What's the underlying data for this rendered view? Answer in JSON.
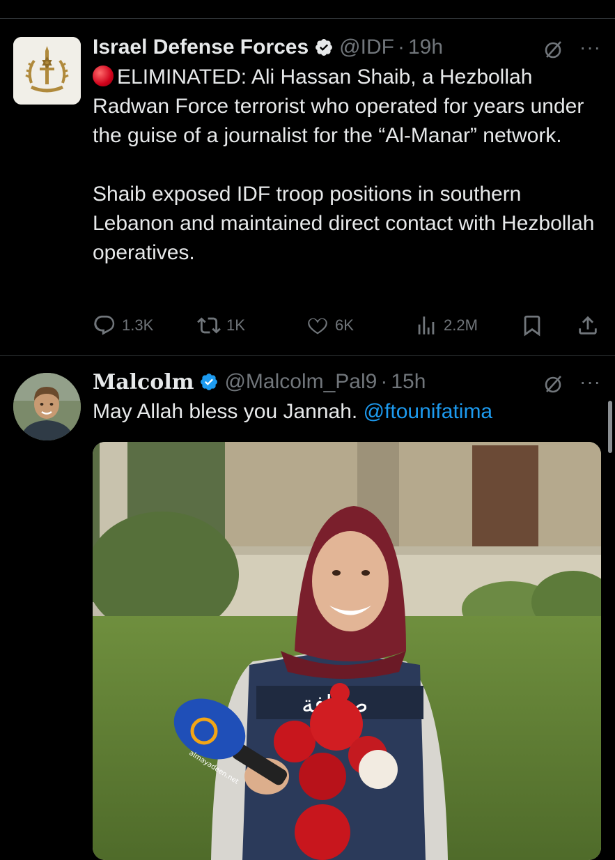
{
  "tweets": [
    {
      "name": "Israel Defense Forces",
      "handle": "@IDF",
      "time": "19h",
      "paragraphs": [
        "ELIMINATED: Ali Hassan Shaib, a Hezbollah Radwan Force terrorist who operated for years under the guise of a journalist for the “Al-Manar” network.",
        "Shaib exposed IDF troop positions in southern Lebanon and maintained direct contact with Hezbollah operatives."
      ],
      "stats": {
        "replies": "1.3K",
        "reposts": "1K",
        "likes": "6K",
        "views": "2.2M"
      }
    },
    {
      "name": "Malcolm",
      "handle": "@Malcolm_Pal9",
      "time": "15h",
      "text": "May Allah bless you Jannah.",
      "mention": "@ftounifatima",
      "image": {
        "vest_text": "صحافة",
        "mic_logo": "almayadeen.net"
      }
    }
  ],
  "icons": {
    "verified": "verified-badge-icon",
    "grok": "grok-icon",
    "more": "more-icon",
    "reply": "reply-icon",
    "repost": "repost-icon",
    "like": "like-icon",
    "views": "views-icon",
    "bookmark": "bookmark-icon",
    "share": "share-icon"
  },
  "colors": {
    "background": "#000000",
    "text": "#e7e9ea",
    "secondary": "#71767b",
    "link": "#1d9bf0",
    "verified": "#1d9bf0",
    "divider": "#2f3336"
  },
  "more_glyph": "···"
}
